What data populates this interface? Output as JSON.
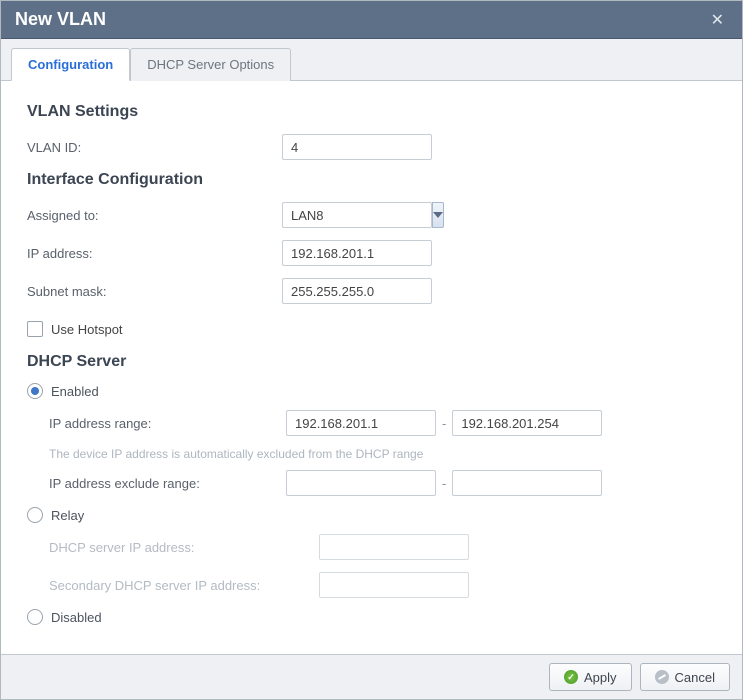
{
  "title": "New VLAN",
  "tabs": [
    {
      "label": "Configuration",
      "active": true
    },
    {
      "label": "DHCP Server Options",
      "active": false
    }
  ],
  "sections": {
    "vlan_settings": "VLAN Settings",
    "interface_config": "Interface Configuration",
    "dhcp_server": "DHCP Server"
  },
  "labels": {
    "vlan_id": "VLAN ID:",
    "assigned_to": "Assigned to:",
    "ip_address": "IP address:",
    "subnet_mask": "Subnet mask:",
    "use_hotspot": "Use Hotspot",
    "enabled": "Enabled",
    "ip_range": "IP address range:",
    "range_note": "The device IP address is automatically excluded from the DHCP range",
    "exclude_range": "IP address exclude range:",
    "relay": "Relay",
    "dhcp_server_ip": "DHCP server IP address:",
    "secondary_dhcp_ip": "Secondary DHCP server IP address:",
    "disabled": "Disabled"
  },
  "values": {
    "vlan_id": "4",
    "assigned_to": "LAN8",
    "ip_address": "192.168.201.1",
    "subnet_mask": "255.255.255.0",
    "use_hotspot": false,
    "dhcp_mode": "enabled",
    "range_start": "192.168.201.1",
    "range_end": "192.168.201.254",
    "exclude_start": "",
    "exclude_end": "",
    "dhcp_server_ip": "",
    "secondary_dhcp_ip": ""
  },
  "buttons": {
    "apply": "Apply",
    "cancel": "Cancel"
  }
}
